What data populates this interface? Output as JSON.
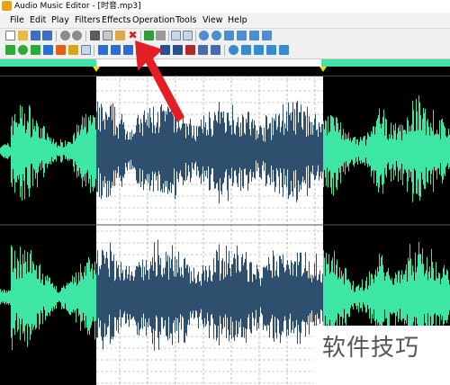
{
  "window": {
    "title": "Audio Music Editor - [时音.mp3]"
  },
  "menu": {
    "items": [
      {
        "label": "File",
        "name": "menu-file"
      },
      {
        "label": "Edit",
        "name": "menu-edit"
      },
      {
        "label": "Play",
        "name": "menu-play"
      },
      {
        "label": "Filters",
        "name": "menu-filters"
      },
      {
        "label": "Effects",
        "name": "menu-effects"
      },
      {
        "label": "Operation",
        "name": "menu-operation"
      },
      {
        "label": "Tools",
        "name": "menu-tools"
      },
      {
        "label": "View",
        "name": "menu-view"
      },
      {
        "label": "Help",
        "name": "menu-help"
      }
    ]
  },
  "toolbar1": {
    "icons": [
      "new-file-icon",
      "open-file-icon",
      "save-icon",
      "save-as-icon",
      "undo-icon",
      "redo-icon",
      "cut-icon",
      "copy-icon",
      "paste-icon",
      "delete-icon",
      "play-selection-icon",
      "trim-icon",
      "select-mode-icon",
      "draw-mode-icon",
      "zoom-in-icon",
      "zoom-out-icon",
      "zoom-fit-icon",
      "zoom-selection-icon",
      "zoom-vertical-in-icon",
      "zoom-vertical-out-icon"
    ]
  },
  "toolbar2": {
    "icons": [
      "play-icon",
      "play-loop-icon",
      "play-to-end-icon",
      "pause-icon",
      "stop-icon",
      "record-icon",
      "go-start-icon",
      "rewind-icon",
      "fast-forward-icon",
      "go-end-icon",
      "marker-icon",
      "cue-icon",
      "region-icon",
      "snap-icon",
      "align-icon",
      "normalize-icon",
      "fade-icon",
      "reverse-icon",
      "loop-icon",
      "mark-in-icon",
      "mark-out-icon"
    ]
  },
  "colors": {
    "waveform_unselected": "#3ee6a6",
    "waveform_selected": "#2f4f6f",
    "background_unselected": "#000000",
    "background_selected": "#ffffff",
    "annotation_arrow": "#e31e24"
  },
  "selection": {
    "start_fraction": 0.214,
    "end_fraction": 0.718
  },
  "watermark": {
    "text": "软件技巧"
  }
}
